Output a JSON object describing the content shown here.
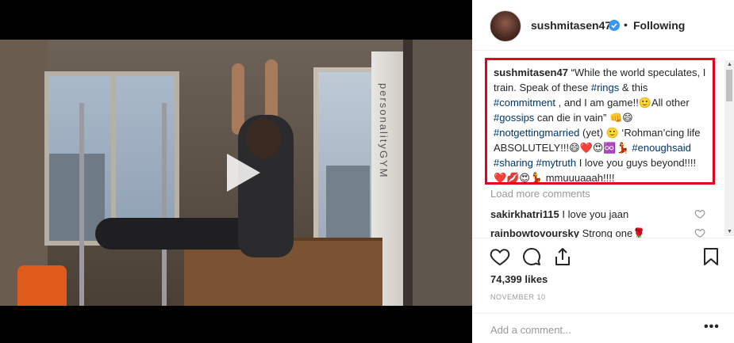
{
  "post": {
    "username": "sushmitasen47",
    "verified": true,
    "separator": "•",
    "follow_status": "Following"
  },
  "media": {
    "panel_text": "personalityGYM",
    "play_icon": "play-icon"
  },
  "caption": {
    "username": "sushmitasen47",
    "segments": [
      {
        "t": " “While the world speculates, I train. Speak of these ",
        "h": false
      },
      {
        "t": "#rings",
        "h": true
      },
      {
        "t": " & this ",
        "h": false
      },
      {
        "t": "#commitment",
        "h": true
      },
      {
        "t": " , and I am game!!🙂All other ",
        "h": false
      },
      {
        "t": "#gossips",
        "h": true
      },
      {
        "t": " can die in vain” 👊😄 ",
        "h": false
      },
      {
        "t": "#notgettingmarried",
        "h": true
      },
      {
        "t": " (yet) 🙂 ‘Rohman’cing life ABSOLUTELY!!!😄❤️😍♾️💃 ",
        "h": false
      },
      {
        "t": "#enoughsaid",
        "h": true
      },
      {
        "t": " ",
        "h": false
      },
      {
        "t": "#sharing",
        "h": true
      },
      {
        "t": " ",
        "h": false
      },
      {
        "t": "#mytruth",
        "h": true
      },
      {
        "t": " I love you guys beyond!!!!❤️💋😍💃 mmuuuaaah!!!!",
        "h": false
      }
    ]
  },
  "comments": {
    "load_more": "Load more comments",
    "items": [
      {
        "user": "sakirkhatri115",
        "text": "I love you jaan"
      },
      {
        "user": "rainbowtovoursky",
        "text": "Strong one🌹"
      }
    ]
  },
  "actions": {
    "like_icon": "heart-icon",
    "comment_icon": "comment-icon",
    "share_icon": "share-icon",
    "save_icon": "bookmark-icon"
  },
  "likes": "74,399 likes",
  "date": "NOVEMBER 10",
  "add_comment": {
    "placeholder": "Add a comment...",
    "more": "•••"
  },
  "colors": {
    "highlight_border": "#e4001b",
    "hashtag": "#003569",
    "verified": "#3897f0"
  }
}
